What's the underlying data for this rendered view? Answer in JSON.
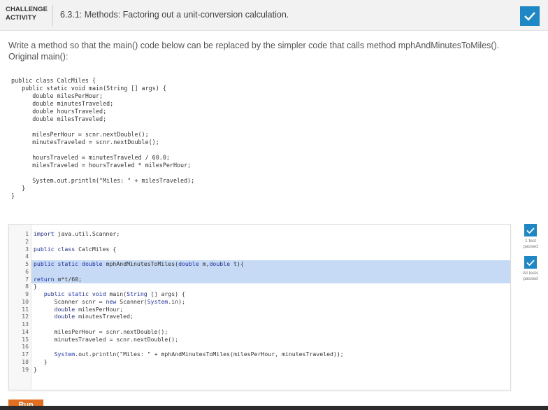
{
  "header": {
    "activity_line1": "CHALLENGE",
    "activity_line2": "ACTIVITY",
    "title": "6.3.1: Methods: Factoring out a unit-conversion calculation."
  },
  "instructions": {
    "line1": "Write a method so that the main() code below can be replaced by the simpler code that calls method mphAndMinutesToMiles().",
    "line2": "Original main():"
  },
  "original_code": [
    "public class CalcMiles {",
    "   public static void main(String [] args) {",
    "      double milesPerHour;",
    "      double minutesTraveled;",
    "      double hoursTraveled;",
    "      double milesTraveled;",
    "",
    "      milesPerHour = scnr.nextDouble();",
    "      minutesTraveled = scnr.nextDouble();",
    "",
    "      hoursTraveled = minutesTraveled / 60.0;",
    "      milesTraveled = hoursTraveled * milesPerHour;",
    "",
    "      System.out.println(\"Miles: \" + milesTraveled);",
    "   }",
    "}"
  ],
  "editor": {
    "lines": [
      {
        "num": "1",
        "code": "import java.util.Scanner;"
      },
      {
        "num": "2",
        "code": ""
      },
      {
        "num": "3",
        "code": "public class CalcMiles {"
      },
      {
        "num": "4",
        "code": ""
      },
      {
        "num": "5",
        "code": "public static double mphAndMinutesToMiles(double m,double t){"
      },
      {
        "num": "6",
        "code": ""
      },
      {
        "num": "7",
        "code": "return m*t/60;"
      },
      {
        "num": "8",
        "code": "}"
      },
      {
        "num": "9",
        "code": "   public static void main(String [] args) {"
      },
      {
        "num": "10",
        "code": "      Scanner scnr = new Scanner(System.in);"
      },
      {
        "num": "11",
        "code": "      double milesPerHour;"
      },
      {
        "num": "12",
        "code": "      double minutesTraveled;"
      },
      {
        "num": "13",
        "code": ""
      },
      {
        "num": "14",
        "code": "      milesPerHour = scnr.nextDouble();"
      },
      {
        "num": "15",
        "code": "      minutesTraveled = scnr.nextDouble();"
      },
      {
        "num": "16",
        "code": ""
      },
      {
        "num": "17",
        "code": "      System.out.println(\"Miles: \" + mphAndMinutesToMiles(milesPerHour, minutesTraveled));"
      },
      {
        "num": "18",
        "code": "   }"
      },
      {
        "num": "19",
        "code": "}"
      }
    ],
    "highlighted_lines": [
      "5",
      "6",
      "7"
    ]
  },
  "tests": {
    "test1_line1": "1 test",
    "test1_line2": "passed",
    "test2_line1": "All tests",
    "test2_line2": "passed"
  },
  "run_button": {
    "label": "Run"
  },
  "colors": {
    "accent": "#1e88c7",
    "highlight": "#c6daf5",
    "run": "#e26e21"
  }
}
